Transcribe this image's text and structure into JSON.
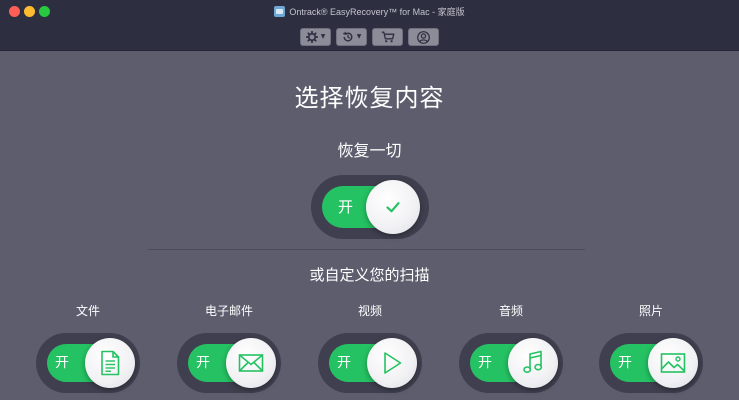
{
  "window": {
    "title": "Ontrack® EasyRecovery™ for Mac - 家庭版"
  },
  "toolbar": {
    "buttons": [
      {
        "icon": "gear-icon",
        "has_dropdown": true
      },
      {
        "icon": "history-icon",
        "has_dropdown": true
      },
      {
        "icon": "cart-icon",
        "has_dropdown": false
      },
      {
        "icon": "user-icon",
        "has_dropdown": false
      }
    ]
  },
  "main": {
    "title": "选择恢复内容",
    "recover_all": {
      "label": "恢复一切",
      "toggle_text": "开",
      "state": "on"
    },
    "custom_label": "或自定义您的扫描",
    "categories": [
      {
        "label": "文件",
        "toggle_text": "开",
        "icon": "document-icon"
      },
      {
        "label": "电子邮件",
        "toggle_text": "开",
        "icon": "email-icon"
      },
      {
        "label": "视频",
        "toggle_text": "开",
        "icon": "play-icon"
      },
      {
        "label": "音频",
        "toggle_text": "开",
        "icon": "music-note-icon"
      },
      {
        "label": "照片",
        "toggle_text": "开",
        "icon": "photo-icon"
      }
    ]
  },
  "colors": {
    "accent_green": "#25c263",
    "background": "#5d5d6e",
    "titlebar": "#2d2f41"
  }
}
